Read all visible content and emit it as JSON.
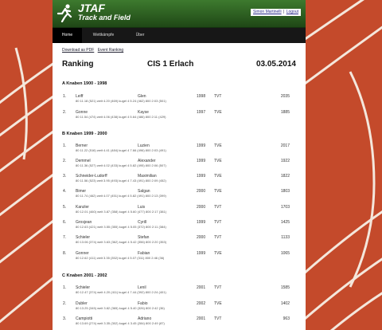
{
  "header": {
    "brand_title": "JTAF",
    "brand_subtitle": "Track and Field",
    "user_label": "Simon Martinelli",
    "separator": "|",
    "logout_label": "Logout"
  },
  "nav": {
    "items": [
      "Home",
      "Wettkämpfe",
      "Über"
    ]
  },
  "content": {
    "download_pdf": "Download as PDF",
    "event_ranking": "Event Ranking",
    "title_left": "Ranking",
    "title_center": "CIS 1 Erlach",
    "title_right": "03.05.2014",
    "sections": [
      {
        "title": "A Knaben 1900 - 1998",
        "rows": [
          {
            "rank": "1.",
            "last": "Leiff",
            "first": "Glen",
            "year": "1998",
            "club": "TVT",
            "points": "2035",
            "detail": "80 11.18 (521) weit 4.20 (469) kugel 4 5.24 (462) 800 2:03 (501)"
          },
          {
            "rank": "2.",
            "last": "Gonne",
            "first": "Kayse",
            "year": "1997",
            "club": "TVE",
            "points": "1885",
            "detail": "80 11.54 (474) weit 4.06 (438) kugel 4 5.64 (486) 800 2:11 (429)"
          }
        ]
      },
      {
        "title": "B Knaben 1999 - 2000",
        "rows": [
          {
            "rank": "1.",
            "last": "Berner",
            "first": "Luzien",
            "year": "1999",
            "club": "TVE",
            "points": "2017",
            "detail": "80 11.22 (516) weit 4.41 (484) kugel 4 7.66 (496) 800 2:03 (491)"
          },
          {
            "rank": "2.",
            "last": "Demmel",
            "first": "Alexander",
            "year": "1999",
            "club": "TVE",
            "points": "1922",
            "detail": "80 11.36 (527) weit 4.02 (433) kugel 4 5.82 (495) 800 2:06 (507)"
          },
          {
            "rank": "3.",
            "last": "Schneider-Ludorff",
            "first": "Maximilian",
            "year": "1999",
            "club": "TVE",
            "points": "1822",
            "detail": "80 11.56 (523) weit 3.95 (493) kugel 4 7.43 (491) 800 2:09 (452)"
          },
          {
            "rank": "4.",
            "last": "Bimer",
            "first": "Salgan",
            "year": "2000",
            "club": "TVE",
            "points": "1803",
            "detail": "80 11.74 (462) weit 4.07 (451) kugel 4 5.82 (491) 800 2:13 (399)"
          },
          {
            "rank": "5.",
            "last": "Kanzler",
            "first": "Luis",
            "year": "2000",
            "club": "TVT",
            "points": "1703",
            "detail": "80 12.01 (460) weit 3.87 (358) kugel 4 5.60 (477) 800 2:17 (381)"
          },
          {
            "rank": "6.",
            "last": "Grosjean",
            "first": "Cyrill",
            "year": "1999",
            "club": "TVT",
            "points": "1425",
            "detail": "80 12.63 (421) weit 3.55 (355) kugel 4 5.05 (372) 800 2:11 (384)"
          },
          {
            "rank": "7.",
            "last": "Schieler",
            "first": "Stefan",
            "year": "2000",
            "club": "TVT",
            "points": "1133",
            "detail": "80 13.06 (374) weit 3.63 (362) kugel 4 5.42 (356) 800 2:20 (353)"
          },
          {
            "rank": "8.",
            "last": "Gonner",
            "first": "Fabian",
            "year": "1999",
            "club": "TVE",
            "points": "1065",
            "detail": "80 12.62 (411) weit 3.35 (352) kugel 4 5.07 (311) 800 2:46 (36)"
          }
        ]
      },
      {
        "title": "C Knaben 2001 - 2002",
        "rows": [
          {
            "rank": "1.",
            "last": "Schieler",
            "first": "Lenil",
            "year": "2001",
            "club": "TVT",
            "points": "1585",
            "detail": "80 12.47 (374) weit 4.20 (411) kugel 4 7.44 (392) 800 2:24 (401)"
          },
          {
            "rank": "2.",
            "last": "Dubler",
            "first": "Fabio",
            "year": "2002",
            "club": "TVE",
            "points": "1402",
            "detail": "80 13.25 (345) weit 3.82 (365) kugel 4 5.40 (326) 800 2:42 (36)"
          },
          {
            "rank": "3.",
            "last": "Campiotti",
            "first": "Adriano",
            "year": "2001",
            "club": "TVT",
            "points": "963",
            "detail": "80 13.69 (274) weit 3.35 (302) kugel 4 3.45 (284) 800 2:49 (87)"
          }
        ]
      }
    ]
  },
  "colors": {
    "track": "#c8492a",
    "header": "#2f6a24",
    "nav": "#171717"
  }
}
